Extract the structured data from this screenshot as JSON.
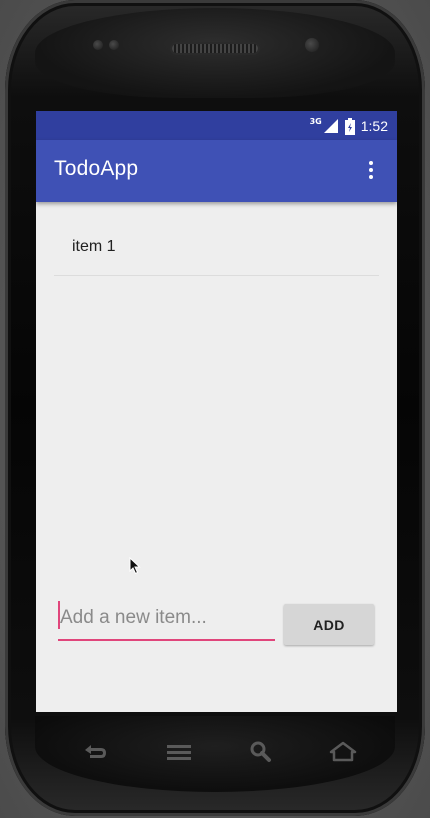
{
  "status_bar": {
    "network_type": "3G",
    "time": "1:52"
  },
  "app_bar": {
    "title": "TodoApp",
    "menu_icon": "more-vert-icon"
  },
  "todo_list": {
    "items": [
      {
        "label": "item 1"
      }
    ]
  },
  "composer": {
    "input_value": "",
    "input_placeholder": "Add a new item...",
    "add_button_label": "ADD"
  },
  "device_keys": [
    "back-icon",
    "menu-icon",
    "search-icon",
    "home-icon"
  ],
  "colors": {
    "status_bar": "#303f9f",
    "app_bar": "#3f51b5",
    "accent": "#e0457b",
    "screen_background": "#eeeeee",
    "button_background": "#d6d6d6"
  }
}
